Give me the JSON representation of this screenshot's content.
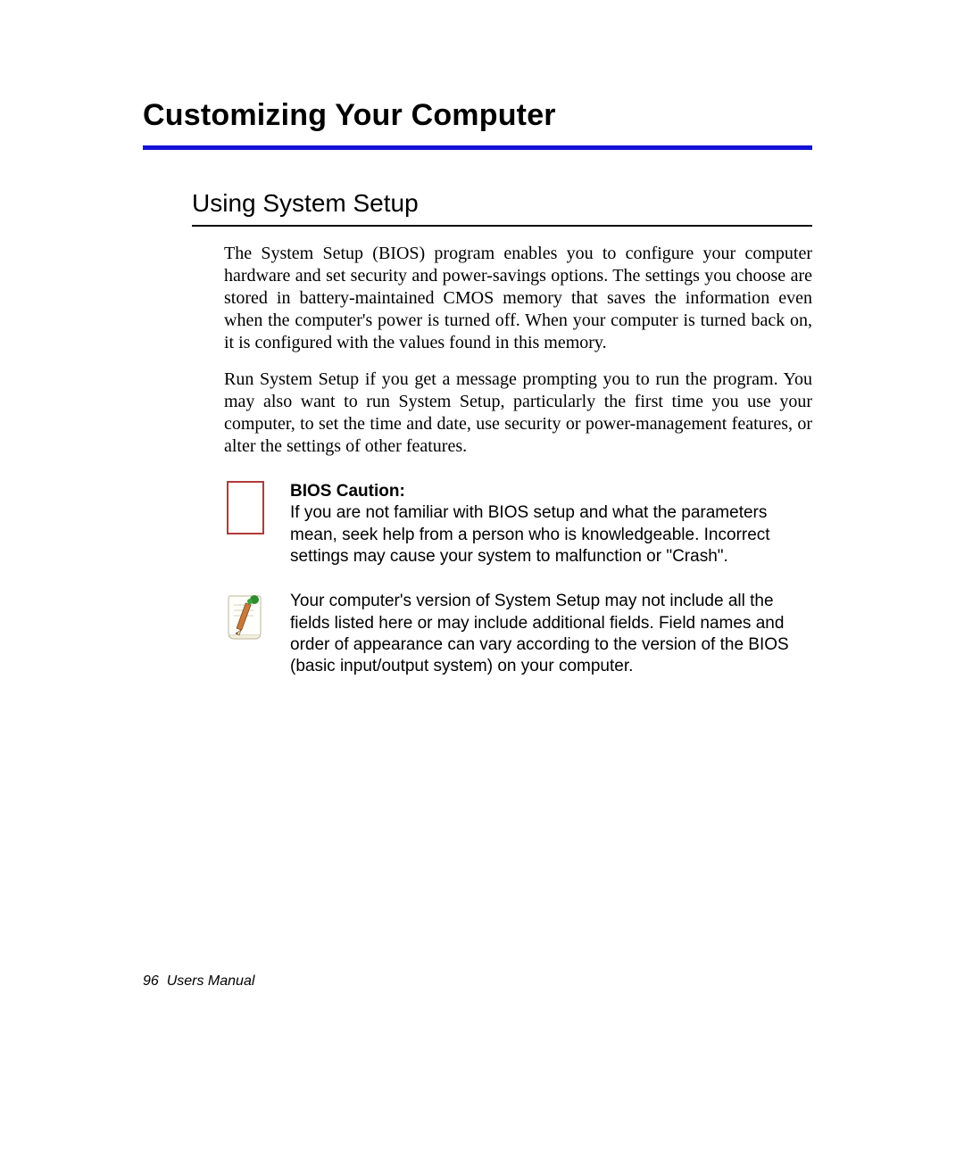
{
  "chapter_title": "Customizing Your Computer",
  "section_title": "Using System Setup",
  "paragraph_1": "The System Setup (BIOS) program enables you to configure your computer hardware and set security and power-savings options. The settings you choose are stored in battery-maintained CMOS memory that saves the information even when the computer's power is turned off. When your computer is turned back on, it is configured with the values found in this memory.",
  "paragraph_2": "Run System Setup if you get a message prompting you to run the program. You may also want to run System Setup, particularly the first time you use your computer, to set the time and date, use security or power-management features, or alter the settings of other features.",
  "caution": {
    "heading": "BIOS Caution:",
    "body": "If you are not familiar with BIOS setup and what the parameters mean, seek help from a person who is knowledgeable. Incorrect settings may cause your system to malfunction or \"Crash\"."
  },
  "note": {
    "body": "Your computer's version of System Setup may not include all the fields listed here or may include additional fields. Field names and order of appearance can vary according to the version of the BIOS (basic input/output system) on your computer."
  },
  "footer": {
    "page_number": "96",
    "label": "Users Manual"
  }
}
